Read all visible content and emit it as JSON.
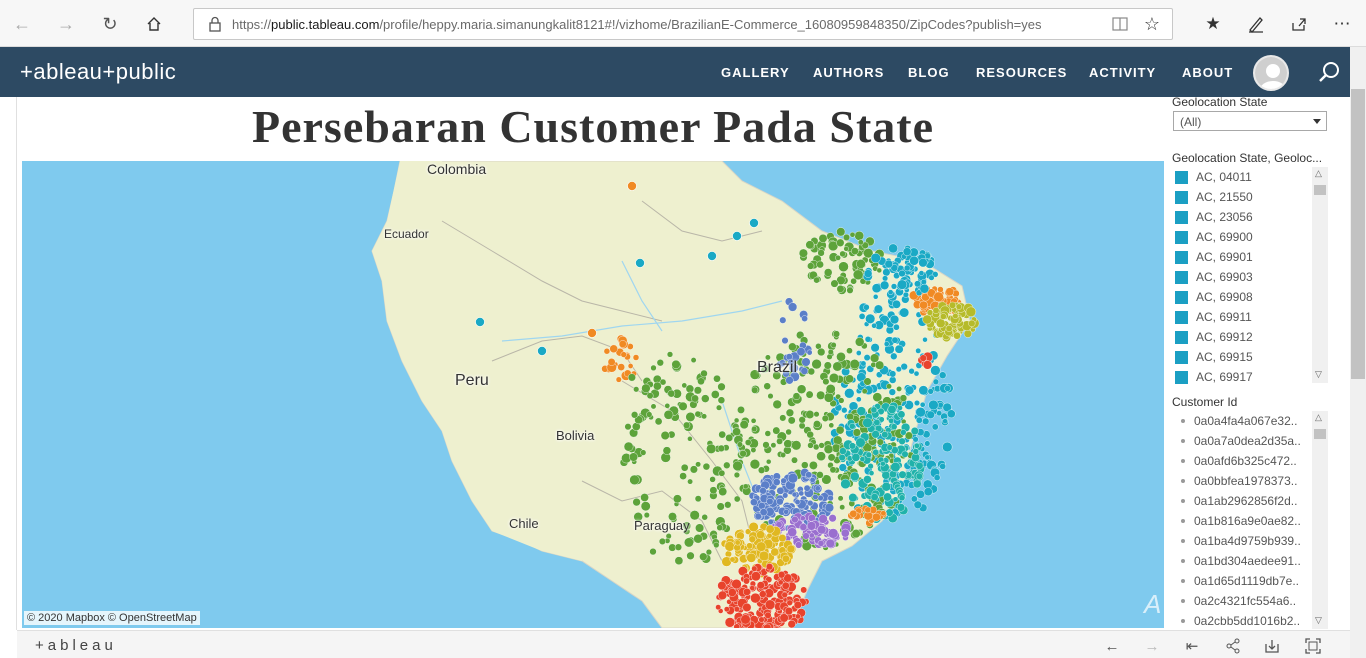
{
  "browser": {
    "url_prefix": "https://",
    "url_host": "public.tableau.com",
    "url_path": "/profile/heppy.maria.simanungkalit8121#!/vizhome/BrazilianE-Commerce_16080959848350/ZipCodes?publish=yes"
  },
  "header": {
    "logo": "+ableau+public",
    "nav": [
      "GALLERY",
      "AUTHORS",
      "BLOG",
      "RESOURCES",
      "ACTIVITY",
      "ABOUT"
    ]
  },
  "dashboard": {
    "title": "Persebaran Customer Pada State",
    "map": {
      "labels": [
        "Colombia",
        "Ecuador",
        "Peru",
        "Bolivia",
        "Brazil",
        "Paraguay",
        "Chile"
      ],
      "attribution": "© 2020 Mapbox  © OpenStreetMap",
      "colors": {
        "ocean": "#7fcaee",
        "land": "#eef0cf",
        "teal": "#1aa9c5",
        "green": "#5da33a",
        "cyan": "#20b2aa",
        "blue": "#5b7fc8",
        "purple": "#9a6fcf",
        "orange": "#f08a24",
        "red": "#e8432c",
        "yellow": "#e0b821",
        "olive": "#b6bb2a"
      }
    }
  },
  "filters": {
    "state_title": "Geolocation State",
    "state_value": "(All)",
    "zip_title": "Geolocation State, Geoloc...",
    "zip_items": [
      "AC, 04011",
      "AC, 21550",
      "AC, 23056",
      "AC, 69900",
      "AC, 69901",
      "AC, 69903",
      "AC, 69908",
      "AC, 69911",
      "AC, 69912",
      "AC, 69915",
      "AC, 69917"
    ],
    "customer_title": "Customer Id",
    "customer_items": [
      "0a0a4fa4a067e32..",
      "0a0a7a0dea2d35a..",
      "0a0afd6b325c472..",
      "0a0bbfea1978373..",
      "0a1ab2962856f2d..",
      "0a1b816a9e0ae82..",
      "0a1ba4d9759b939..",
      "0a1bd304aedee91..",
      "0a1d65d1119db7e..",
      "0a2c4321fc554a6..",
      "0a2cbb5dd1016b2.."
    ]
  },
  "footer": {
    "brand": "+ableau"
  }
}
